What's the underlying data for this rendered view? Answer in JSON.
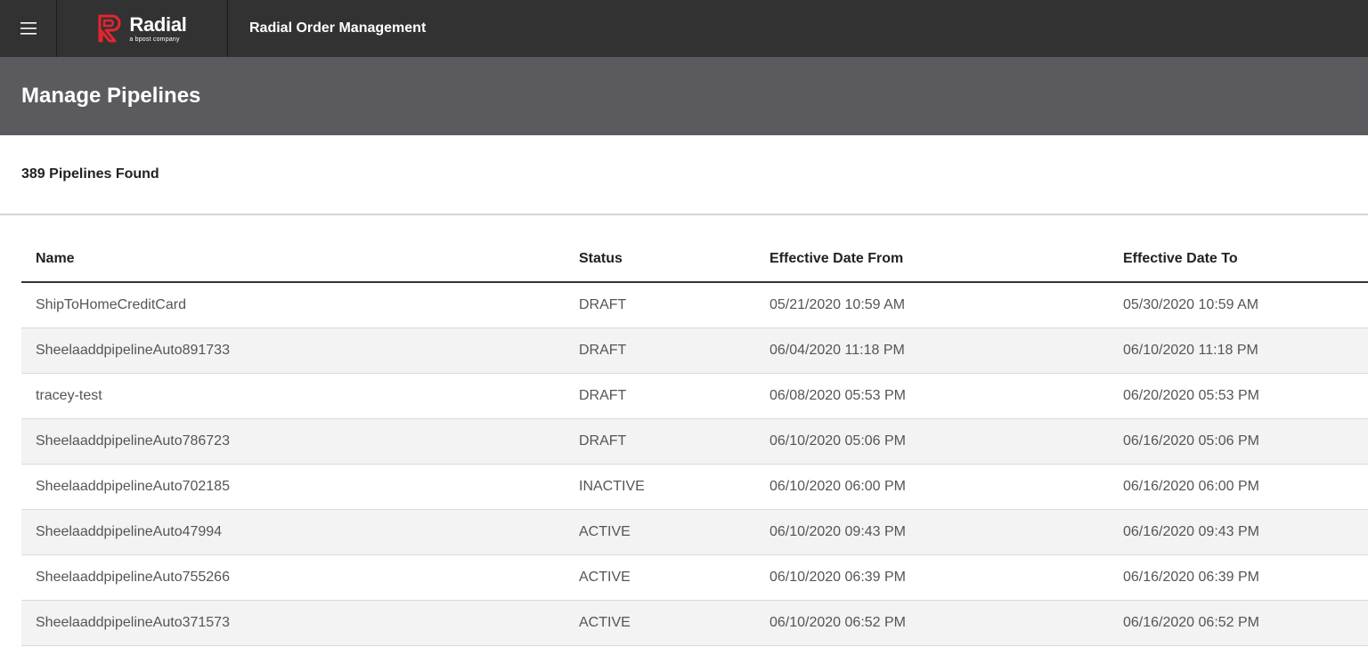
{
  "brand": {
    "name": "Radial",
    "tagline": "a bpost company",
    "accent_color": "#e3262e"
  },
  "header": {
    "app_title": "Radial Order Management",
    "menu_icon": "hamburger-icon"
  },
  "page": {
    "title": "Manage Pipelines",
    "result_count": "389 Pipelines Found"
  },
  "table": {
    "columns": [
      "Name",
      "Status",
      "Effective Date From",
      "Effective Date To"
    ],
    "rows": [
      {
        "name": "ShipToHomeCreditCard",
        "status": "DRAFT",
        "from": "05/21/2020 10:59 AM",
        "to": "05/30/2020 10:59 AM"
      },
      {
        "name": "SheelaaddpipelineAuto891733",
        "status": "DRAFT",
        "from": "06/04/2020 11:18 PM",
        "to": "06/10/2020 11:18 PM"
      },
      {
        "name": "tracey-test",
        "status": "DRAFT",
        "from": "06/08/2020 05:53 PM",
        "to": "06/20/2020 05:53 PM"
      },
      {
        "name": "SheelaaddpipelineAuto786723",
        "status": "DRAFT",
        "from": "06/10/2020 05:06 PM",
        "to": "06/16/2020 05:06 PM"
      },
      {
        "name": "SheelaaddpipelineAuto702185",
        "status": "INACTIVE",
        "from": "06/10/2020 06:00 PM",
        "to": "06/16/2020 06:00 PM"
      },
      {
        "name": "SheelaaddpipelineAuto47994",
        "status": "ACTIVE",
        "from": "06/10/2020 09:43 PM",
        "to": "06/16/2020 09:43 PM"
      },
      {
        "name": "SheelaaddpipelineAuto755266",
        "status": "ACTIVE",
        "from": "06/10/2020 06:39 PM",
        "to": "06/16/2020 06:39 PM"
      },
      {
        "name": "SheelaaddpipelineAuto371573",
        "status": "ACTIVE",
        "from": "06/10/2020 06:52 PM",
        "to": "06/16/2020 06:52 PM"
      }
    ]
  }
}
